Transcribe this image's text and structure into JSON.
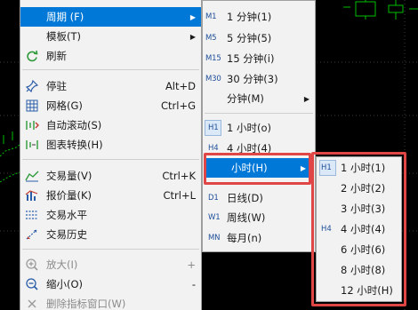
{
  "colors": {
    "menu_bg": "#f2f2f2",
    "highlight_blue": "#0078d7",
    "annotation_red": "#e04646",
    "chart_bg": "#000000",
    "chart_green": "#00c000",
    "code_blue": "#1e4f9a"
  },
  "main_menu": {
    "items": [
      {
        "label": "周期 (F)",
        "icon": "",
        "shortcut": "",
        "submenu": true
      },
      {
        "label": "模板(T)",
        "icon": "",
        "shortcut": "",
        "submenu": true
      },
      {
        "label": "刷新",
        "icon": "refresh-icon",
        "shortcut": ""
      },
      {
        "label": "停驻",
        "icon": "pin-icon",
        "shortcut": "Alt+D"
      },
      {
        "label": "网格(G)",
        "icon": "grid-icon",
        "shortcut": "Ctrl+G"
      },
      {
        "label": "自动滚动(S)",
        "icon": "auto-scroll-icon",
        "shortcut": ""
      },
      {
        "label": "图表转换(H)",
        "icon": "chart-shift-icon",
        "shortcut": ""
      },
      {
        "label": "交易量(V)",
        "icon": "volume-icon",
        "shortcut": "Ctrl+K"
      },
      {
        "label": "报价量(K)",
        "icon": "tick-volume-icon",
        "shortcut": "Ctrl+L"
      },
      {
        "label": "交易水平",
        "icon": "trade-levels-icon",
        "shortcut": ""
      },
      {
        "label": "交易历史",
        "icon": "trade-history-icon",
        "shortcut": ""
      },
      {
        "label": "放大(I)",
        "icon": "zoom-in-icon",
        "shortcut": "+"
      },
      {
        "label": "缩小(O)",
        "icon": "zoom-out-icon",
        "shortcut": "-"
      },
      {
        "label": "删除指标窗口(W)",
        "icon": "delete-icon",
        "shortcut": ""
      }
    ]
  },
  "period_menu": {
    "items": [
      {
        "code": "M1",
        "label": "1 分钟(1)"
      },
      {
        "code": "M5",
        "label": "5 分钟(5)"
      },
      {
        "code": "M15",
        "label": "15 分钟(i)"
      },
      {
        "code": "M30",
        "label": "30 分钟(3)"
      },
      {
        "code": "",
        "label": "分钟(M)",
        "submenu": true
      },
      {
        "code": "H1",
        "label": "1 小时(o)",
        "checked": true
      },
      {
        "code": "H4",
        "label": "4 小时(4)"
      },
      {
        "code": "",
        "label": "小时(H)",
        "submenu": true
      },
      {
        "code": "D1",
        "label": "日线(D)"
      },
      {
        "code": "W1",
        "label": "周线(W)"
      },
      {
        "code": "MN",
        "label": "每月(n)"
      }
    ]
  },
  "hour_menu": {
    "items": [
      {
        "code": "H1",
        "label": "1 小时(1)",
        "checked": true
      },
      {
        "code": "",
        "label": "2 小时(2)"
      },
      {
        "code": "",
        "label": "3 小时(3)"
      },
      {
        "code": "H4",
        "label": "4 小时(4)"
      },
      {
        "code": "",
        "label": "6 小时(6)"
      },
      {
        "code": "",
        "label": "8 小时(8)"
      },
      {
        "code": "",
        "label": "12 小时(H)"
      }
    ]
  }
}
